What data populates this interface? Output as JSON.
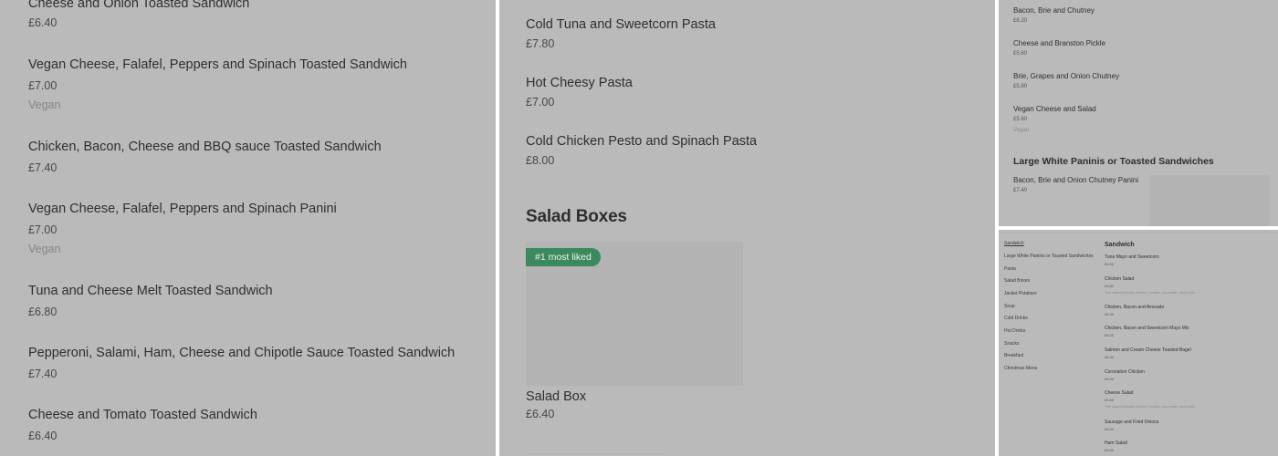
{
  "panel1": {
    "items": [
      {
        "name": "Cheese and Onion Toasted Sandwich",
        "price": "£6.40"
      },
      {
        "name": "Vegan Cheese, Falafel, Peppers and Spinach Toasted Sandwich",
        "price": "£7.00",
        "tag": "Vegan"
      },
      {
        "name": "Chicken, Bacon, Cheese and BBQ sauce Toasted Sandwich",
        "price": "£7.40"
      },
      {
        "name": "Vegan Cheese, Falafel, Peppers and Spinach Panini",
        "price": "£7.00",
        "tag": "Vegan"
      },
      {
        "name": "Tuna and Cheese Melt Toasted Sandwich",
        "price": "£6.80"
      },
      {
        "name": "Pepperoni, Salami, Ham, Cheese and Chipotle Sauce Toasted Sandwich",
        "price": "£7.40"
      },
      {
        "name": "Cheese and Tomato Toasted Sandwich",
        "price": "£6.40"
      }
    ]
  },
  "panel2": {
    "items": [
      {
        "name": "Cold Tuna and Sweetcorn Pasta",
        "price": "£7.80"
      },
      {
        "name": "Hot Cheesy Pasta",
        "price": "£7.00"
      },
      {
        "name": "Cold Chicken Pesto and Spinach Pasta",
        "price": "£8.00"
      }
    ],
    "section_title": "Salad Boxes",
    "badge": "#1 most liked",
    "featured": {
      "name": "Salad Box",
      "price": "£6.40"
    }
  },
  "panel3": {
    "items": [
      {
        "name": "Bacon, Brie and Chutney",
        "price": "£6.20"
      },
      {
        "name": "Cheese and Branston Pickle",
        "price": "£5.60"
      },
      {
        "name": "Brie, Grapes and Onion Chutney",
        "price": "£5.80"
      },
      {
        "name": "Vegan Cheese and Salad",
        "price": "£5.60",
        "tag": "Vegan"
      }
    ],
    "section_title": "Large White Paninis or Toasted Sandwiches",
    "section_item": {
      "name": "Bacon, Brie and Onion Chutney Panini",
      "price": "£7.40"
    }
  },
  "panel4": {
    "nav": [
      "Sandwich",
      "Large White Paninis or Toasted Sandwiches",
      "Pasta",
      "Salad Boxes",
      "Jacket Potatoes",
      "Soup",
      "Cold Drinks",
      "Hot Drinks",
      "Snacks",
      "Breakfast",
      "Christmas Menu"
    ],
    "section_title": "Sandwich",
    "items": [
      {
        "name": "Tuna Mayo and Sweetcorn",
        "price": "£5.60"
      },
      {
        "name": "Chicken Salad",
        "price": "£5.80",
        "desc": "The salad includes lettuce, tomato, cucumber and onion"
      },
      {
        "name": "Chicken, Bacon and Avocado",
        "price": "£6.40"
      },
      {
        "name": "Chicken, Bacon and Sweetcorn Mayo Mix",
        "price": "£6.00"
      },
      {
        "name": "Salmon and Cream Cheese Toasted Bagel",
        "price": "£6.40"
      },
      {
        "name": "Coronation Chicken",
        "price": "£6.00"
      },
      {
        "name": "Cheese Salad",
        "price": "£5.60",
        "desc": "The salad includes lettuce, tomato, cucumber and onion"
      },
      {
        "name": "Sausage and Fried Onions",
        "price": "£6.00"
      },
      {
        "name": "Ham Salad",
        "price": "£5.80"
      }
    ]
  }
}
